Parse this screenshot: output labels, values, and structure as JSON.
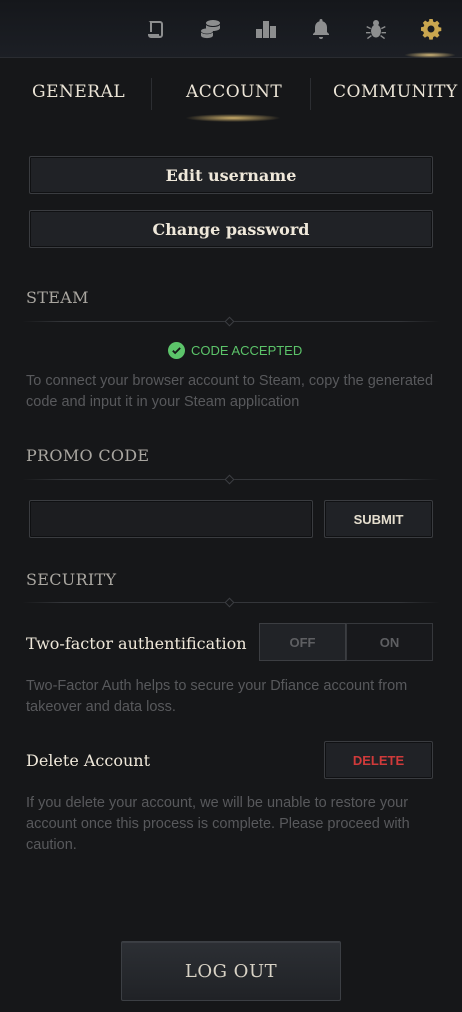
{
  "topbar": {
    "icons": [
      "scroll-icon",
      "coins-icon",
      "leaderboard-icon",
      "bell-icon",
      "bug-icon",
      "gear-icon"
    ],
    "active_icon": "gear-icon",
    "accent_color": "#c9a64f"
  },
  "tabs": {
    "items": [
      {
        "label": "GENERAL"
      },
      {
        "label": "ACCOUNT"
      },
      {
        "label": "COMMUNITY"
      }
    ],
    "active": "ACCOUNT"
  },
  "account": {
    "edit_username_label": "Edit username",
    "change_password_label": "Change password"
  },
  "steam": {
    "title": "STEAM",
    "status_text": "CODE ACCEPTED",
    "status_color": "#5cc46a",
    "description": "To connect your browser account to Steam, copy the generated code and input it in your Steam application"
  },
  "promo": {
    "title": "PROMO CODE",
    "input_value": "",
    "submit_label": "SUBMIT"
  },
  "security": {
    "title": "SECURITY",
    "two_factor_label": "Two-factor authentification",
    "toggle_off_label": "OFF",
    "toggle_on_label": "ON",
    "toggle_selected": "OFF",
    "two_factor_description": "Two-Factor Auth helps to secure your Dfiance account from takeover and data loss.",
    "delete_label": "Delete Account",
    "delete_button_label": "DELETE",
    "delete_color": "#d03a3a",
    "delete_description": "If you delete your account, we will be unable to restore your account once this process is complete. Please proceed with caution."
  },
  "logout_label": "LOG OUT"
}
